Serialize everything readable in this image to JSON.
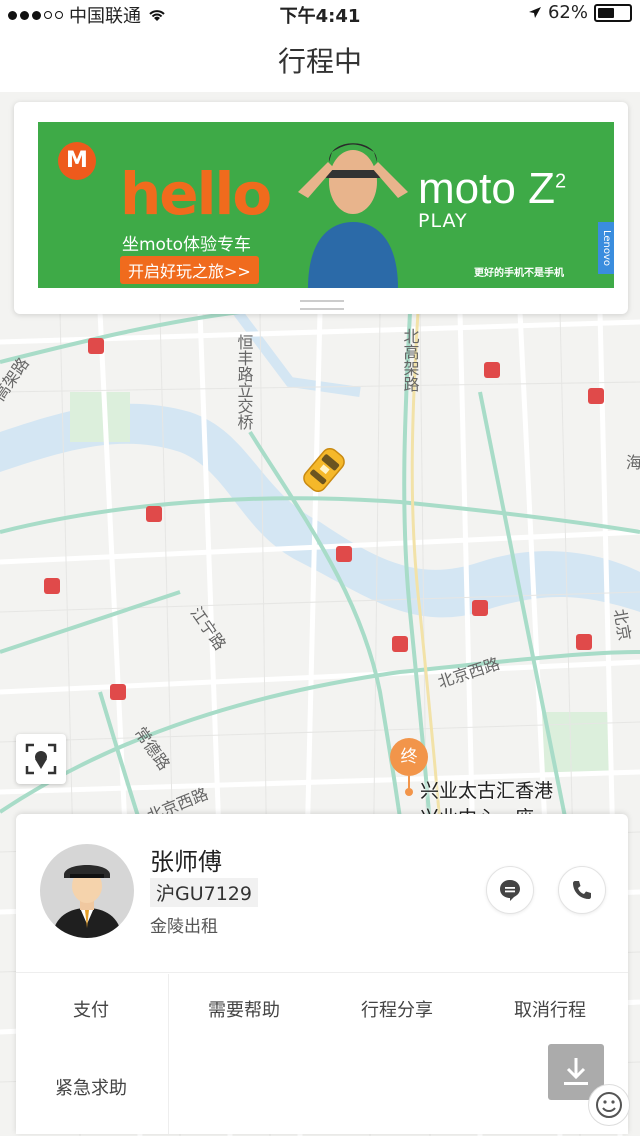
{
  "status_bar": {
    "carrier": "中国联通",
    "time": "下午4:41",
    "battery_percent": "62%",
    "battery_level": 0.62
  },
  "header": {
    "title": "行程中"
  },
  "ad": {
    "hello": "hello",
    "slogan": "坐moto体验专车",
    "cta": "开启好玩之旅>>",
    "brand": "moto",
    "brand_suffix": "Z",
    "brand_sup": "2",
    "brand_line": "PLAY",
    "tagline": "更好的手机不是手机",
    "lenovo": "Lenovo",
    "logo_letter": "M"
  },
  "map": {
    "labels": [
      {
        "text": "北高架路",
        "vertical": true
      },
      {
        "text": "恒丰路立交桥",
        "vertical": true
      },
      {
        "text": "江宁路"
      },
      {
        "text": "北京西路"
      },
      {
        "text": "常德路"
      },
      {
        "text": "北京西路"
      },
      {
        "text": "高架路"
      },
      {
        "text": "北京"
      },
      {
        "text": "海"
      }
    ],
    "destination_pin": "终",
    "destination_name": "兴业太古汇香港",
    "destination_name_2": "兴业中心一座"
  },
  "driver": {
    "name": "张师傅",
    "plate": "沪GU7129",
    "company": "金陵出租"
  },
  "actions": {
    "pay": "支付",
    "help": "需要帮助",
    "share": "行程分享",
    "cancel": "取消行程",
    "sos": "紧急求助"
  },
  "colors": {
    "map_road": "#ffffff",
    "map_green_road": "#a8dcc8",
    "map_water": "#cfe3f2",
    "ad_green": "#3eaa47",
    "accent_orange": "#f06b1d",
    "dest_orange": "#f2954a",
    "taxi_yellow": "#f5b82a"
  },
  "icons": {
    "locate": "locate-icon",
    "message": "message-icon",
    "phone": "phone-icon",
    "download": "download-icon",
    "smile": "smile-icon",
    "taxi": "taxi-icon",
    "subway": "subway-icon"
  }
}
